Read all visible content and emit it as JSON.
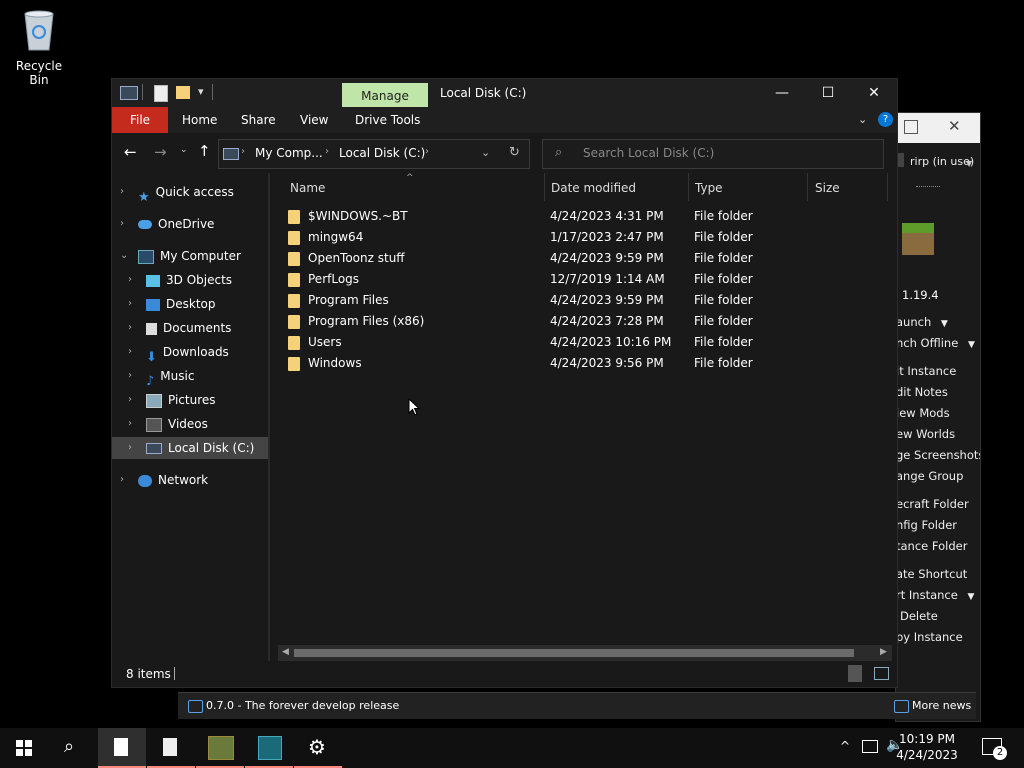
{
  "desktop": {
    "recycle_bin_label": "Recycle Bin"
  },
  "explorer": {
    "title": "Local Disk (C:)",
    "manage_label": "Manage",
    "drive_tools_label": "Drive Tools",
    "tabs": {
      "file": "File",
      "home": "Home",
      "share": "Share",
      "view": "View"
    },
    "window_buttons": {
      "minimize": "—",
      "maximize": "☐",
      "close": "✕"
    },
    "address": {
      "crumb1": "My Comp...",
      "crumb2": "Local Disk (C:)"
    },
    "search_placeholder": "Search Local Disk (C:)",
    "columns": {
      "name": "Name",
      "date": "Date modified",
      "type": "Type",
      "size": "Size"
    },
    "files": [
      {
        "name": "$WINDOWS.~BT",
        "date": "4/24/2023 4:31 PM",
        "type": "File folder"
      },
      {
        "name": "mingw64",
        "date": "1/17/2023 2:47 PM",
        "type": "File folder"
      },
      {
        "name": "OpenToonz stuff",
        "date": "4/24/2023 9:59 PM",
        "type": "File folder"
      },
      {
        "name": "PerfLogs",
        "date": "12/7/2019 1:14 AM",
        "type": "File folder"
      },
      {
        "name": "Program Files",
        "date": "4/24/2023 9:59 PM",
        "type": "File folder"
      },
      {
        "name": "Program Files (x86)",
        "date": "4/24/2023 7:28 PM",
        "type": "File folder"
      },
      {
        "name": "Users",
        "date": "4/24/2023 10:16 PM",
        "type": "File folder"
      },
      {
        "name": "Windows",
        "date": "4/24/2023 9:56 PM",
        "type": "File folder"
      }
    ],
    "nav": {
      "quick_access": "Quick access",
      "onedrive": "OneDrive",
      "my_computer": "My Computer",
      "objects3d": "3D Objects",
      "desktop": "Desktop",
      "documents": "Documents",
      "downloads": "Downloads",
      "music": "Music",
      "pictures": "Pictures",
      "videos": "Videos",
      "local_disk": "Local Disk (C:)",
      "network": "Network"
    },
    "status_items": "8 items"
  },
  "launcher": {
    "account": "rirp (in use)",
    "version": "1.19.4",
    "menu": [
      "aunch",
      "nch Offline",
      "it Instance",
      "dit Notes",
      "iew Mods",
      "ew Worlds",
      "ge Screenshots",
      "ange Group",
      "ecraft Folder",
      "nfig Folder",
      "tance Folder",
      "ate Shortcut",
      "rt Instance",
      "Delete",
      "py Instance"
    ],
    "news_text": "0.7.0 - The forever develop release",
    "more_news": "More news"
  },
  "taskbar": {
    "time": "10:19 PM",
    "date": "4/24/2023",
    "notifications": "2"
  },
  "colors": {
    "file_tab": "#c42b1c",
    "manage_tab": "#bfe6a8",
    "accent": "#0078d7"
  }
}
